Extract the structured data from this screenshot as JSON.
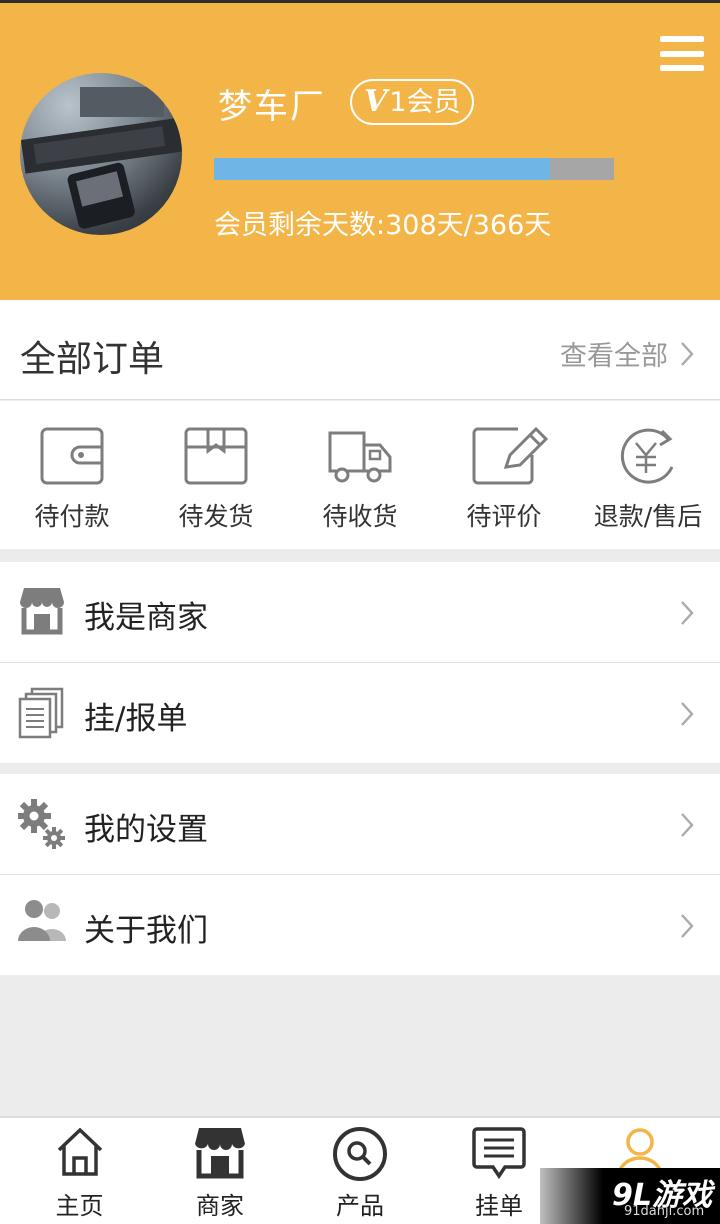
{
  "header": {
    "user_name": "梦车厂",
    "vip_level": "V",
    "vip_suffix": "1会员",
    "membership_progress": 0.84,
    "days_text": "会员剩余天数:308天/366天"
  },
  "orders": {
    "title": "全部订单",
    "view_all": "查看全部",
    "items": [
      {
        "label": "待付款",
        "icon": "wallet-icon"
      },
      {
        "label": "待发货",
        "icon": "package-icon"
      },
      {
        "label": "待收货",
        "icon": "truck-icon"
      },
      {
        "label": "待评价",
        "icon": "review-icon"
      },
      {
        "label": "退款/售后",
        "icon": "refund-icon"
      }
    ]
  },
  "menu": {
    "merchant": "我是商家",
    "listing": "挂/报单",
    "settings": "我的设置",
    "about": "关于我们"
  },
  "tabbar": {
    "items": [
      {
        "label": "主页",
        "icon": "home-icon"
      },
      {
        "label": "商家",
        "icon": "store-icon"
      },
      {
        "label": "产品",
        "icon": "search-icon"
      },
      {
        "label": "挂单",
        "icon": "message-list-icon"
      },
      {
        "label": "",
        "icon": "user-icon"
      }
    ]
  },
  "watermark": {
    "big": "9L游戏",
    "small": "91danji.com"
  },
  "colors": {
    "header": "#f3b548",
    "progress_fill": "#6fb6e7",
    "progress_track": "#a6a6a6",
    "icon_gray": "#7d7d7d"
  }
}
